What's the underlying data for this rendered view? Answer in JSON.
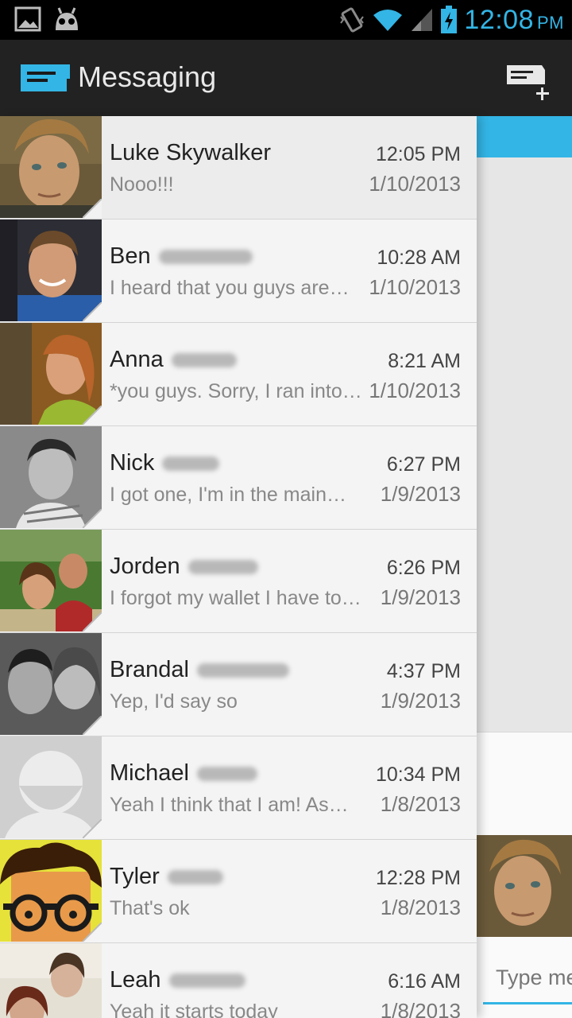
{
  "status_bar": {
    "time": "12:08",
    "ampm": "PM",
    "icons": [
      "gallery-icon",
      "android-robot-icon",
      "vibrate-icon",
      "wifi-icon",
      "signal-icon",
      "battery-charging-icon"
    ]
  },
  "action_bar": {
    "title": "Messaging",
    "compose_icon": "new-message-icon"
  },
  "conversations": [
    {
      "name": "Luke Skywalker",
      "time": "12:05 PM",
      "snippet": "Nooo!!!",
      "date": "1/10/2013"
    },
    {
      "name": "Ben",
      "time": "10:28 AM",
      "snippet": "I heard that you guys are…",
      "date": "1/10/2013"
    },
    {
      "name": "Anna",
      "time": "8:21 AM",
      "snippet": "*you guys. Sorry, I ran into…",
      "date": "1/10/2013"
    },
    {
      "name": "Nick",
      "time": "6:27 PM",
      "snippet": "I got one, I'm in the main…",
      "date": "1/9/2013"
    },
    {
      "name": "Jorden",
      "time": "6:26 PM",
      "snippet": "I forgot my wallet I have to…",
      "date": "1/9/2013"
    },
    {
      "name": "Brandal",
      "time": "4:37 PM",
      "snippet": "Yep, I'd say so",
      "date": "1/9/2013"
    },
    {
      "name": "Michael",
      "time": "10:34 PM",
      "snippet": "Yeah I think that I am! As…",
      "date": "1/8/2013"
    },
    {
      "name": "Tyler",
      "time": "12:28 PM",
      "snippet": "That's ok",
      "date": "1/8/2013"
    },
    {
      "name": "Leah",
      "time": "6:16 AM",
      "snippet": "Yeah it starts today",
      "date": "1/8/2013"
    }
  ],
  "conversation_pane": {
    "compose_placeholder": "Type me"
  },
  "colors": {
    "accent": "#33b5e5",
    "action_bar": "#222222",
    "status_bar": "#000000"
  }
}
